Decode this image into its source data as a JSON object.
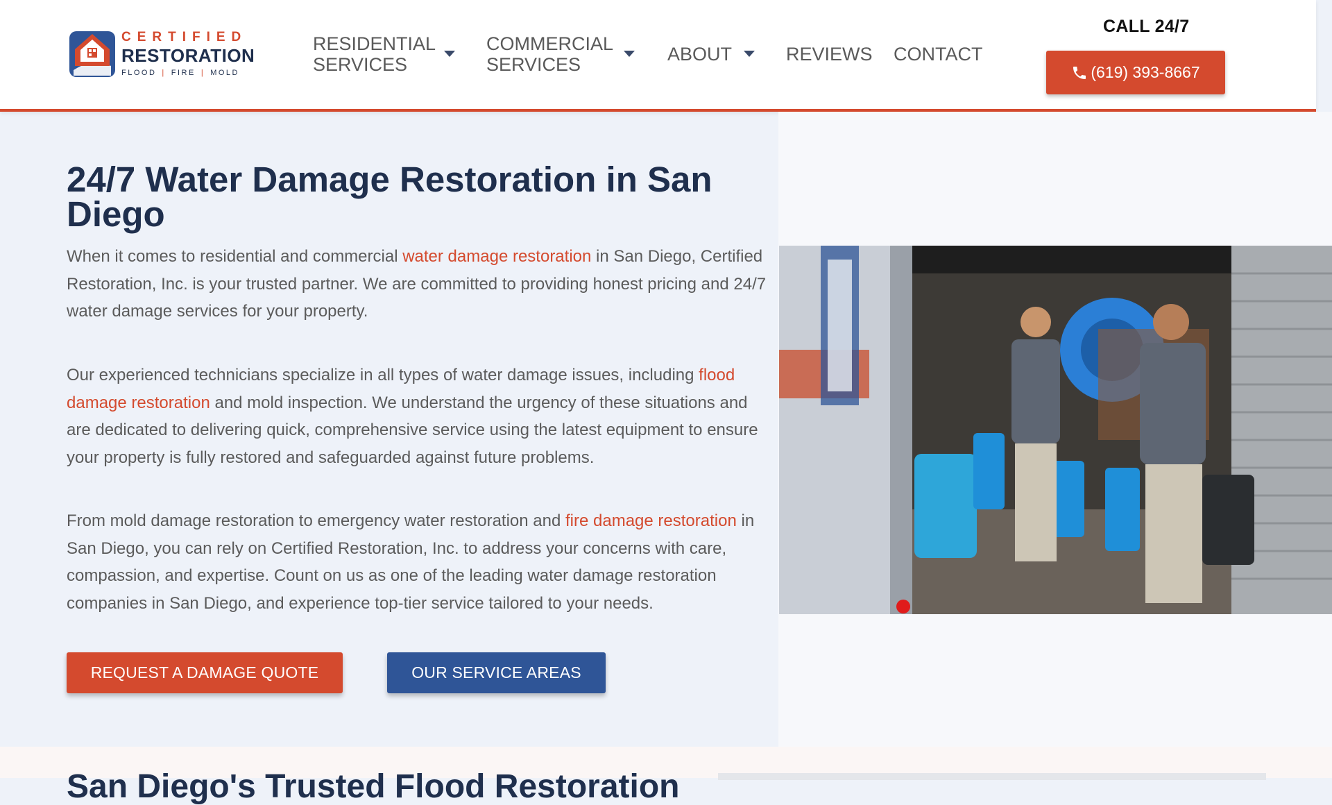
{
  "header": {
    "logo": {
      "word1": "CERTIFIED",
      "word2": "RESTORATION",
      "tag1": "FLOOD",
      "tag2": "FIRE",
      "tag3": "MOLD",
      "sep": "|"
    },
    "nav": [
      {
        "line1": "RESIDENTIAL",
        "line2": "SERVICES",
        "has_dropdown": true
      },
      {
        "line1": "COMMERCIAL",
        "line2": "SERVICES",
        "has_dropdown": true
      },
      {
        "line1": "ABOUT",
        "line2": "",
        "has_dropdown": true
      },
      {
        "line1": "REVIEWS",
        "line2": "",
        "has_dropdown": false
      },
      {
        "line1": "CONTACT",
        "line2": "",
        "has_dropdown": false
      }
    ],
    "call_label": "CALL 24/7",
    "phone": "(619) 393-8667"
  },
  "hero": {
    "title": "24/7 Water Damage Restoration in San Diego",
    "p1": {
      "a": "When it comes to residential and commercial ",
      "link": "water damage restoration",
      "b": " in San Diego, Certified Restoration, Inc. is your trusted partner. We are committed to providing honest pricing and 24/7 water damage services for your property."
    },
    "p2": {
      "a": "Our experienced technicians specialize in all types of water damage issues, including ",
      "link": "flood damage restoration",
      "b": " and mold inspection. We understand the urgency of these situations and are dedicated to delivering quick, comprehensive service using the latest equipment to ensure your property is fully restored and safeguarded against future problems."
    },
    "p3": {
      "a": "From mold damage restoration to emergency water restoration and ",
      "link": "fire damage restoration",
      "b": " in San Diego, you can rely on Certified Restoration, Inc. to address your concerns with care, compassion, and expertise. Count on us as one of the leading water damage restoration companies in San Diego, and experience top-tier service tailored to your needs."
    },
    "btn_quote": "REQUEST A DAMAGE QUOTE",
    "btn_areas": "OUR SERVICE AREAS"
  },
  "next_section": {
    "heading": "San Diego's Trusted Flood Restoration"
  },
  "colors": {
    "accent": "#d44a2e",
    "navy": "#1f2f4d",
    "blue_button": "#2f5597"
  }
}
